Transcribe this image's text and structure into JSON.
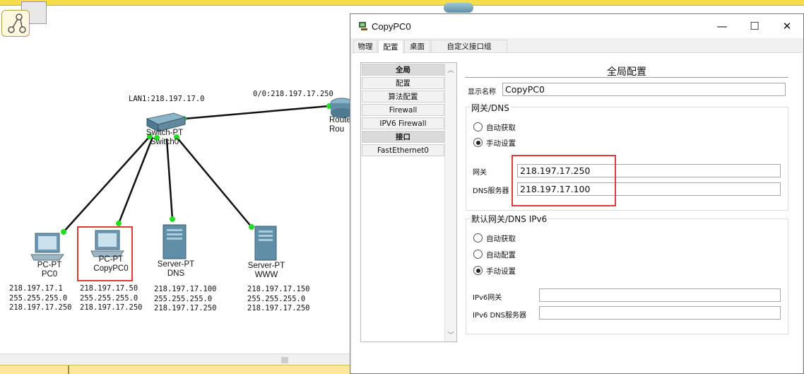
{
  "workspace": {
    "lan_label": "LAN1:218.197.17.0",
    "router_port_label": "0/0:218.197.17.250",
    "switch": {
      "type": "Switch-PT",
      "name": "Switch0"
    },
    "router": {
      "type": "Route",
      "name": "Rou"
    },
    "devices": [
      {
        "type": "PC-PT",
        "name": "PC0",
        "ip": "218.197.17.1",
        "mask": "255.255.255.0",
        "gateway": "218.197.17.250"
      },
      {
        "type": "PC-PT",
        "name": "CopyPC0",
        "ip": "218.197.17.50",
        "mask": "255.255.255.0",
        "gateway": "218.197.17.250"
      },
      {
        "type": "Server-PT",
        "name": "DNS",
        "ip": "218.197.17.100",
        "mask": "255.255.255.0",
        "gateway": "218.197.17.250"
      },
      {
        "type": "Server-PT",
        "name": "WWW",
        "ip": "218.197.17.150",
        "mask": "255.255.255.0",
        "gateway": "218.197.17.250"
      }
    ],
    "colors": {
      "link_light": "#22dd22",
      "highlight": "#e03a3a"
    }
  },
  "dialog": {
    "title": "CopyPC0",
    "tabs": [
      {
        "label": "物理"
      },
      {
        "label": "配置",
        "active": true
      },
      {
        "label": "桌面"
      },
      {
        "label": "自定义接口组"
      }
    ],
    "nav": [
      {
        "label": "全局",
        "header": true
      },
      {
        "label": "配置"
      },
      {
        "label": "算法配置"
      },
      {
        "label": "Firewall"
      },
      {
        "label": "IPV6 Firewall"
      },
      {
        "label": "接口",
        "header": true
      },
      {
        "label": "FastEthernet0"
      }
    ],
    "panel": {
      "title": "全局配置",
      "display_name_label": "显示名称",
      "display_name_value": "CopyPC0",
      "gateway_dns": {
        "title": "网关/DNS",
        "options": [
          "自动获取",
          "手动设置"
        ],
        "selected": "手动设置",
        "gateway_label": "网关",
        "gateway_value": "218.197.17.250",
        "dns_label": "DNS服务器",
        "dns_value": "218.197.17.100"
      },
      "ipv6": {
        "title": "默认网关/DNS IPv6",
        "options": [
          "自动获取",
          "自动配置",
          "手动设置"
        ],
        "selected": "手动设置",
        "gateway_label": "IPv6网关",
        "gateway_value": "",
        "dns_label": "IPv6 DNS服务器",
        "dns_value": ""
      }
    }
  }
}
